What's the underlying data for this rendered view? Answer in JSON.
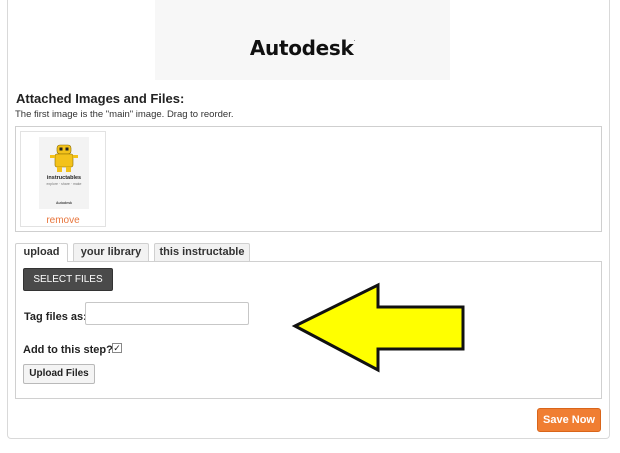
{
  "header": {
    "brand": "Autodesk",
    "brand_mark": "."
  },
  "attachments": {
    "title": "Attached Images and Files:",
    "subtitle": "The first image is the \"main\" image. Drag to reorder.",
    "items": [
      {
        "thumb_title": "instructables",
        "thumb_subtitle": "explore · share · make",
        "thumb_brand": "Autodesk",
        "remove_label": "remove"
      }
    ]
  },
  "tabs": [
    {
      "label": "upload",
      "active": true
    },
    {
      "label": "your library",
      "active": false
    },
    {
      "label": "this instructable",
      "active": false
    }
  ],
  "upload_form": {
    "select_files_label": "SELECT FILES",
    "tag_label": "Tag files as:",
    "tag_value": "",
    "add_to_step_label": "Add to this step?",
    "add_to_step_checked": true,
    "checkbox_glyph": "✓",
    "upload_button_label": "Upload Files"
  },
  "annotation": {
    "icon": "left-arrow-icon",
    "fill": "#ffff00",
    "stroke": "#111111"
  },
  "footer": {
    "save_label": "Save Now",
    "save_color": "#f07e32"
  }
}
